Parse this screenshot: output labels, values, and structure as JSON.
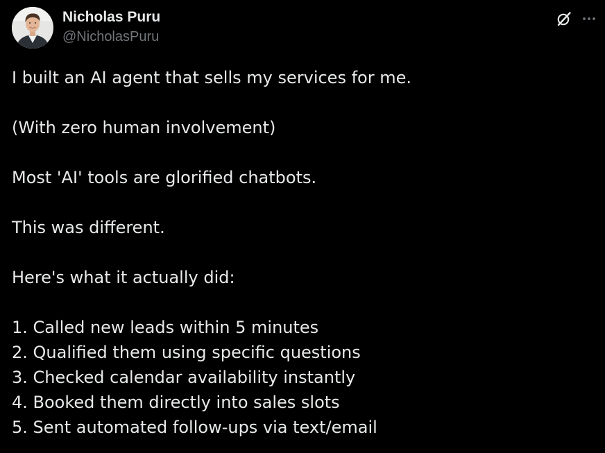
{
  "author": {
    "display_name": "Nicholas Puru",
    "handle": "@NicholasPuru"
  },
  "icons": {
    "grok": "grok-icon",
    "more": "more-icon"
  },
  "colors": {
    "background": "#000000",
    "text": "#e7e9ea",
    "secondary_text": "#71767b"
  },
  "tweet": {
    "paragraphs": [
      "I built an AI agent that sells my services for me.",
      "(With zero human involvement)",
      "Most 'AI' tools are glorified chatbots.",
      "This was different.",
      "Here's what it actually did:"
    ],
    "list": [
      "1. Called new leads within 5 minutes",
      "2. Qualified them using specific questions",
      "3. Checked calendar availability instantly",
      "4. Booked them directly into sales slots",
      "5. Sent automated follow-ups via text/email"
    ]
  }
}
